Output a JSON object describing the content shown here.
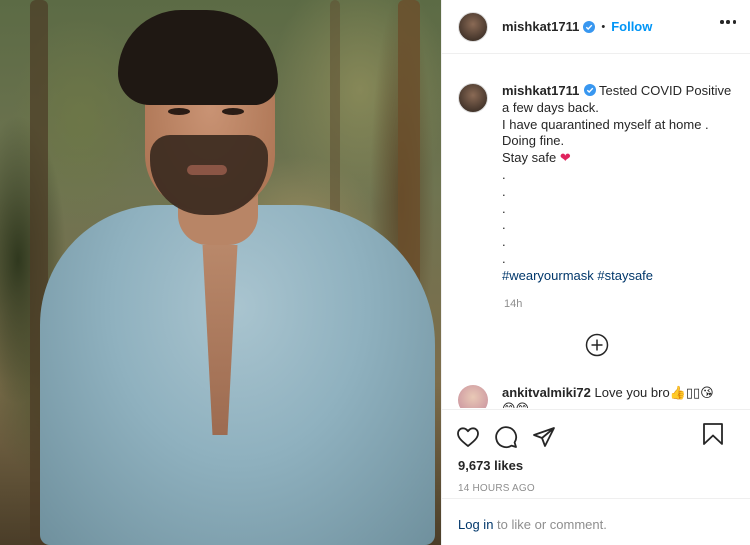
{
  "post": {
    "username": "mishkat1711",
    "dot": "•",
    "follow_label": "Follow",
    "caption_lines": [
      "Tested COVID Positive",
      "a few days back.",
      "I have quarantined myself at home .",
      "Doing fine.",
      "Stay safe"
    ],
    "heart_emoji": "❤",
    "dots": [
      ".",
      ".",
      ".",
      ".",
      ".",
      "."
    ],
    "hashtags": "#wearyourmask #staysafe",
    "caption_time": "14h"
  },
  "comment": {
    "username": "ankitvalmiki72",
    "text": "Love you bro👍",
    "extra": "▯▯😘",
    "second_line": "😁😁"
  },
  "footer": {
    "likes": "9,673 likes",
    "time_ago": "14 HOURS AGO",
    "login_link": "Log in",
    "login_rest": " to like or comment."
  },
  "colors": {
    "link": "#0095f6",
    "hashtag": "#00376b",
    "verified": "#3897f0"
  },
  "icons": [
    "verified-badge-icon",
    "more-options-icon",
    "add-comment-icon",
    "heart-icon",
    "comment-icon",
    "share-icon",
    "bookmark-icon"
  ]
}
